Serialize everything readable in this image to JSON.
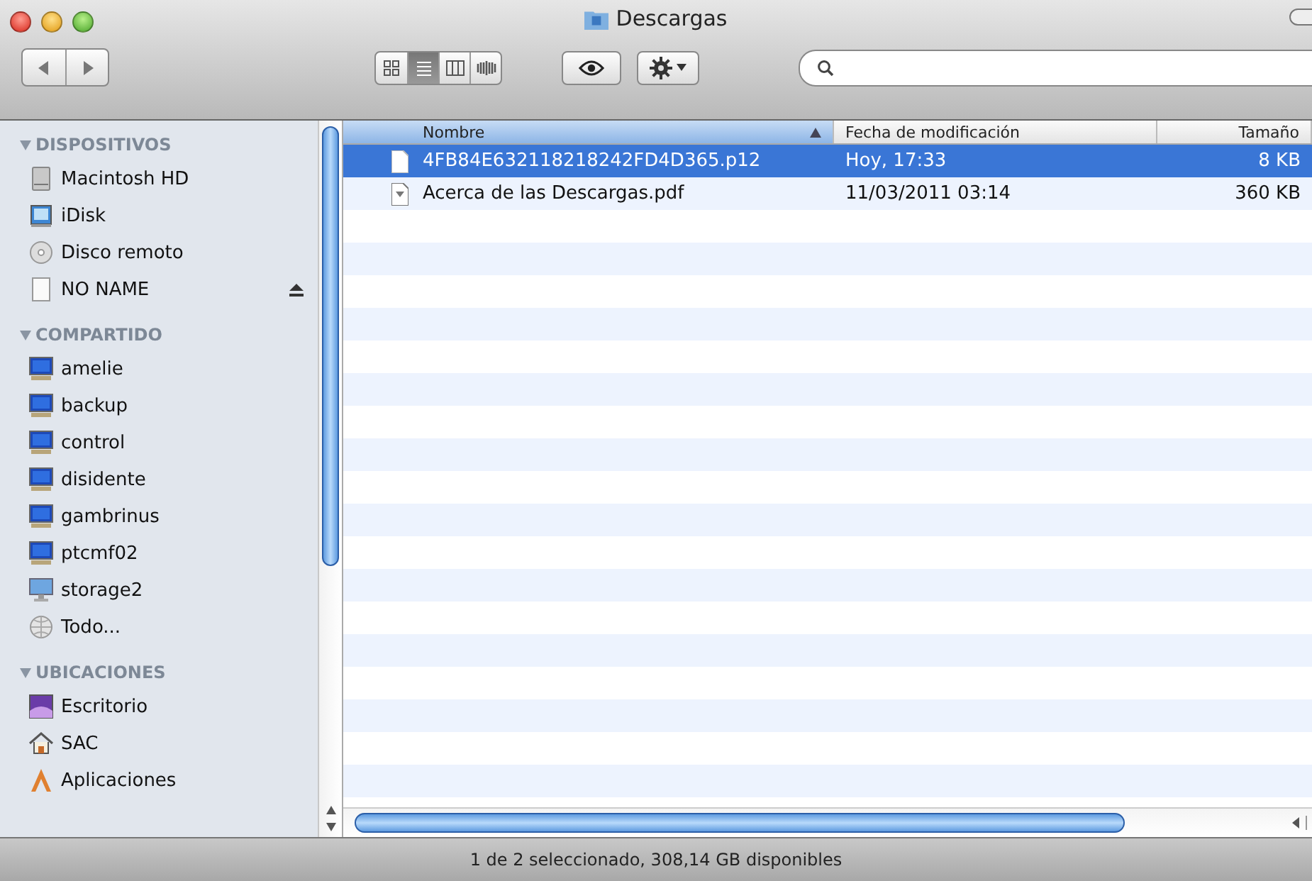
{
  "window": {
    "title": "Descargas"
  },
  "toolbar": {
    "view_buttons": [
      {
        "kind": "icons",
        "selected": false
      },
      {
        "kind": "list",
        "selected": true
      },
      {
        "kind": "columns",
        "selected": false
      },
      {
        "kind": "coverflow",
        "selected": false
      }
    ]
  },
  "sidebar": {
    "sections": [
      {
        "title": "DISPOSITIVOS",
        "expanded": true,
        "items": [
          {
            "label": "Macintosh HD",
            "kind": "disk",
            "eject": false
          },
          {
            "label": "iDisk",
            "kind": "idisk",
            "eject": false
          },
          {
            "label": "Disco remoto",
            "kind": "optical",
            "eject": false
          },
          {
            "label": "NO NAME",
            "kind": "volume",
            "eject": true
          }
        ]
      },
      {
        "title": "COMPARTIDO",
        "expanded": true,
        "items": [
          {
            "label": "amelie",
            "kind": "computer",
            "eject": false
          },
          {
            "label": "backup",
            "kind": "computer",
            "eject": false
          },
          {
            "label": "control",
            "kind": "computer",
            "eject": false
          },
          {
            "label": "disidente",
            "kind": "computer",
            "eject": false
          },
          {
            "label": "gambrinus",
            "kind": "computer",
            "eject": false
          },
          {
            "label": "ptcmf02",
            "kind": "computer",
            "eject": false
          },
          {
            "label": "storage2",
            "kind": "display",
            "eject": false
          },
          {
            "label": "Todo...",
            "kind": "network",
            "eject": false
          }
        ]
      },
      {
        "title": "UBICACIONES",
        "expanded": true,
        "items": [
          {
            "label": "Escritorio",
            "kind": "desktop",
            "eject": false
          },
          {
            "label": "SAC",
            "kind": "home",
            "eject": false
          },
          {
            "label": "Aplicaciones",
            "kind": "apps",
            "eject": false
          }
        ]
      }
    ]
  },
  "table": {
    "columns": [
      {
        "label": "Nombre",
        "sorted": true
      },
      {
        "label": "Fecha de modificación",
        "sorted": false
      },
      {
        "label": "Tamaño",
        "sorted": false
      }
    ],
    "rows": [
      {
        "name": "4FB84E632118218242FD4D365.p12",
        "kind": "blank",
        "date": "Hoy, 17:33",
        "size": "8 KB",
        "selected": true
      },
      {
        "name": "Acerca de las Descargas.pdf",
        "kind": "pdf",
        "date": "11/03/2011 03:14",
        "size": "360 KB",
        "selected": false
      }
    ]
  },
  "status_bar": "1 de 2 seleccionado, 308,14 GB disponibles"
}
